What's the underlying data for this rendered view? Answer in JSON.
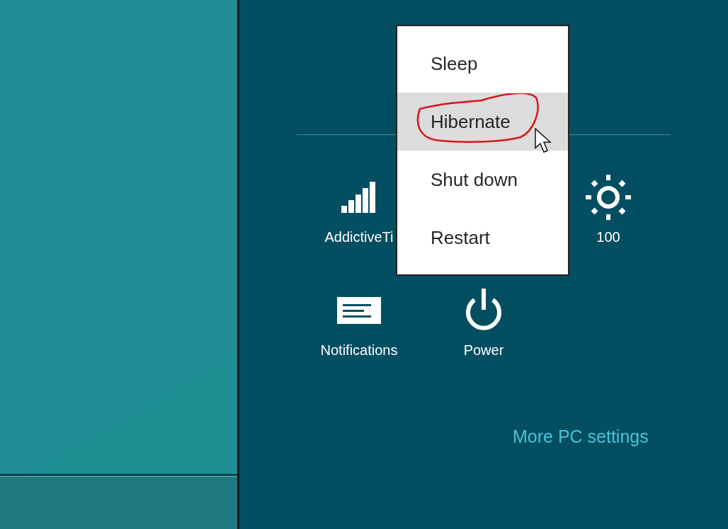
{
  "power_menu": {
    "items": [
      {
        "label": "Sleep",
        "selected": false
      },
      {
        "label": "Hibernate",
        "selected": true
      },
      {
        "label": "Shut down",
        "selected": false
      },
      {
        "label": "Restart",
        "selected": false
      }
    ]
  },
  "settings_tiles": [
    {
      "kind": "wifi",
      "label": "AddictiveTi"
    },
    {
      "kind": "blank"
    },
    {
      "kind": "brightness",
      "label": "100"
    },
    {
      "kind": "notifications",
      "label": "Notifications"
    },
    {
      "kind": "power",
      "label": "Power"
    }
  ],
  "more_link": "More PC settings"
}
